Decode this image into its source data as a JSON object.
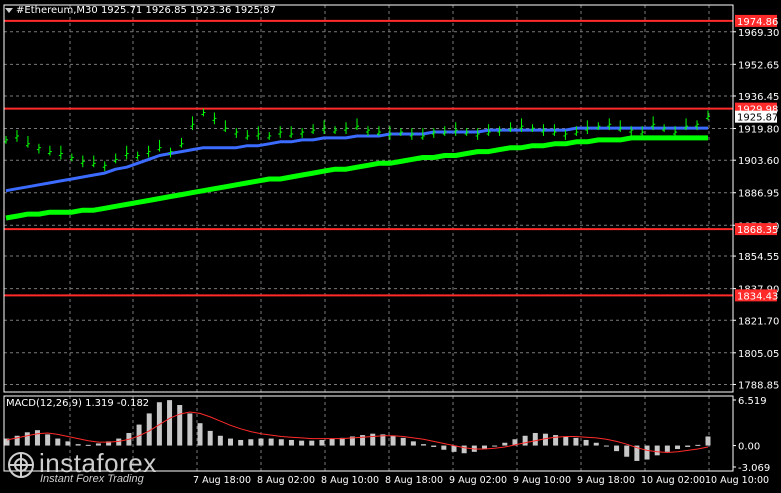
{
  "header": {
    "symbol_line": "#Ethereum,M30  1925.71 1926.85 1923.36 1925.87",
    "macd_label": "MACD(12,26,9) 1.319 -0.182"
  },
  "watermark": {
    "brand": "instaforex",
    "tagline": "Instant Forex Trading"
  },
  "colors": {
    "background": "#000000",
    "price_candles": "#00ff00",
    "ma_slow": "#00ff00",
    "ma_fast": "#3b6bff",
    "level_lines": "#ff2a2a",
    "macd_hist": "#c8c8c8",
    "macd_signal": "#ff2a2a"
  },
  "chart_data": {
    "type": "line",
    "title": "#Ethereum,M30  1925.71 1926.85 1923.36 1925.87",
    "price_axis_ticks": [
      "1969.30",
      "1952.65",
      "1936.45",
      "1919.80",
      "1903.60",
      "1886.95",
      "1870.30",
      "1854.55",
      "1837.90",
      "1821.70",
      "1805.05",
      "1788.85"
    ],
    "time_labels": [
      "7 Aug 18:00",
      "8 Aug 02:00",
      "8 Aug 10:00",
      "8 Aug 18:00",
      "9 Aug 02:00",
      "9 Aug 10:00",
      "9 Aug 18:00",
      "10 Aug 02:00",
      "10 Aug 10:00"
    ],
    "ylim": [
      1785,
      1983
    ],
    "current_price": "1925.87",
    "levels": [
      {
        "label": "1974.86",
        "value": 1974.86
      },
      {
        "label": "1929.98",
        "value": 1929.98
      },
      {
        "label": "1868.35",
        "value": 1868.35
      },
      {
        "label": "1834.43",
        "value": 1834.43
      }
    ],
    "series": [
      {
        "name": "price",
        "values": [
          1914,
          1916,
          1912,
          1910,
          1908,
          1907,
          1905,
          1903,
          1902,
          1901,
          1904,
          1907,
          1906,
          1908,
          1910,
          1908,
          1912,
          1922,
          1928,
          1925,
          1920,
          1918,
          1916,
          1917,
          1916,
          1918,
          1917,
          1918,
          1919,
          1920,
          1919,
          1920,
          1921,
          1919,
          1918,
          1917,
          1918,
          1917,
          1916,
          1918,
          1918,
          1919,
          1918,
          1917,
          1918,
          1919,
          1920,
          1921,
          1920,
          1919,
          1918,
          1917,
          1918,
          1920,
          1921,
          1922,
          1920,
          1919,
          1918,
          1922,
          1920,
          1918,
          1921,
          1922,
          1926
        ]
      },
      {
        "name": "slow_ma",
        "values": [
          1874,
          1875,
          1876,
          1876,
          1877,
          1877,
          1877,
          1878,
          1878,
          1879,
          1880,
          1881,
          1882,
          1883,
          1884,
          1885,
          1886,
          1887,
          1888,
          1889,
          1890,
          1891,
          1892,
          1893,
          1894,
          1894,
          1895,
          1896,
          1897,
          1898,
          1899,
          1899,
          1900,
          1901,
          1902,
          1902,
          1903,
          1904,
          1905,
          1905,
          1906,
          1906,
          1907,
          1908,
          1908,
          1909,
          1910,
          1910,
          1911,
          1911,
          1912,
          1912,
          1913,
          1913,
          1914,
          1914,
          1914,
          1915,
          1915,
          1915,
          1915,
          1915,
          1915,
          1915,
          1915
        ]
      },
      {
        "name": "fast_ma",
        "values": [
          1888,
          1889,
          1890,
          1891,
          1892,
          1893,
          1894,
          1895,
          1896,
          1897,
          1899,
          1900,
          1902,
          1904,
          1906,
          1907,
          1908,
          1909,
          1910,
          1910,
          1910,
          1910,
          1911,
          1911,
          1912,
          1913,
          1913,
          1914,
          1914,
          1915,
          1915,
          1915,
          1916,
          1916,
          1916,
          1917,
          1917,
          1917,
          1917,
          1918,
          1918,
          1918,
          1918,
          1918,
          1919,
          1919,
          1919,
          1919,
          1919,
          1919,
          1919,
          1919,
          1920,
          1920,
          1920,
          1920,
          1920,
          1920,
          1920,
          1920,
          1920,
          1920,
          1920,
          1920,
          1920
        ]
      }
    ],
    "macd": {
      "ticks": [
        "6.519",
        "0.00",
        "-3.069"
      ],
      "ylim": [
        -3.069,
        6.519
      ],
      "histogram": [
        1.0,
        1.4,
        1.9,
        2.2,
        1.6,
        1.0,
        0.6,
        0.2,
        0.1,
        0.3,
        0.6,
        1.0,
        1.8,
        3.0,
        4.6,
        6.2,
        6.5,
        5.8,
        4.6,
        3.2,
        2.1,
        1.4,
        1.0,
        0.8,
        0.9,
        1.0,
        1.0,
        0.9,
        0.8,
        0.7,
        0.7,
        0.8,
        1.0,
        1.1,
        1.3,
        1.5,
        1.7,
        1.6,
        1.4,
        1.1,
        0.6,
        0.2,
        -0.2,
        -0.6,
        -0.9,
        -1.1,
        -0.9,
        -0.5,
        -0.1,
        0.4,
        0.9,
        1.4,
        1.8,
        1.7,
        1.5,
        1.3,
        1.1,
        0.8,
        0.4,
        0.0,
        -0.8,
        -1.6,
        -2.2,
        -2.0,
        -1.4,
        -0.9,
        -0.5,
        -0.2,
        0.1,
        1.3
      ],
      "signal": [
        0.8,
        1.1,
        1.4,
        1.7,
        1.8,
        1.6,
        1.3,
        1.0,
        0.7,
        0.5,
        0.5,
        0.6,
        0.9,
        1.4,
        2.1,
        3.0,
        3.9,
        4.5,
        4.8,
        4.6,
        4.1,
        3.5,
        2.9,
        2.4,
        2.0,
        1.7,
        1.5,
        1.3,
        1.2,
        1.1,
        1.0,
        1.0,
        1.0,
        1.0,
        1.1,
        1.2,
        1.3,
        1.4,
        1.4,
        1.3,
        1.1,
        0.9,
        0.6,
        0.3,
        0.0,
        -0.3,
        -0.5,
        -0.5,
        -0.4,
        -0.2,
        0.1,
        0.4,
        0.7,
        1.0,
        1.2,
        1.3,
        1.3,
        1.2,
        1.1,
        0.9,
        0.6,
        0.2,
        -0.3,
        -0.7,
        -0.9,
        -1.0,
        -0.9,
        -0.7,
        -0.5,
        -0.2
      ]
    }
  }
}
